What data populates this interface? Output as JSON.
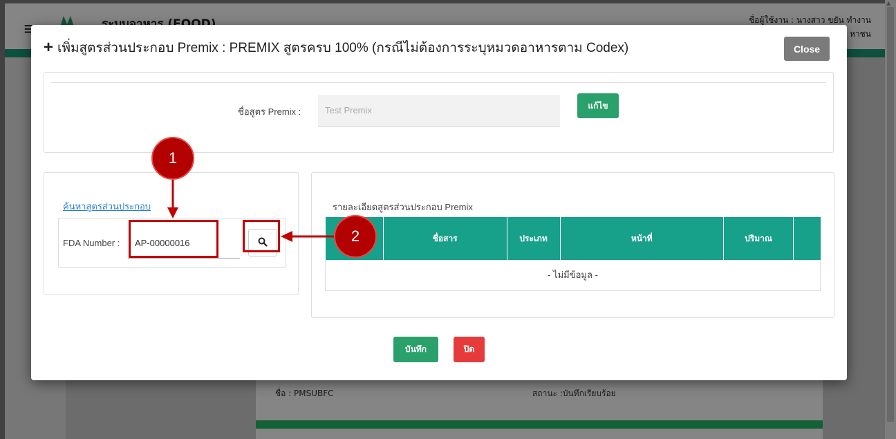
{
  "background": {
    "app_title": "ระบบอาหาร (FOOD)",
    "user_line1": "ชื่อผู้ใช้งาน : นางสาว ขยัน ทำงาน",
    "user_line2": "หาชน",
    "card_name": "ชื่อ : PMSUBFC",
    "card_status": "สถานะ :บันทึกเรียบร้อย"
  },
  "modal": {
    "title": "เพิ่มสูตรส่วนประกอบ Premix : PREMIX สูตรครบ 100% (กรณีไม่ต้องการระบุหมวดอาหารตาม Codex)",
    "close_label": "Close",
    "premix_name_label": "ชื่อสูตร Premix :",
    "premix_name_value": "Test Premix",
    "edit_label": "แก้ไข",
    "search_link": "ค้นหาสูตรส่วนประกอบ",
    "fda_label": "FDA Number :",
    "fda_value": "AP-00000016",
    "detail_title": "รายละเอียดสูตรส่วนประกอบ Premix",
    "table": {
      "headers": [
        "",
        "ชื่อสาร",
        "ประเภท",
        "หน้าที่",
        "ปริมาณ",
        ""
      ],
      "empty_text": "- ไม่มีข้อมูล -"
    },
    "save_label": "บันทึก",
    "cancel_label": "ปิด"
  },
  "annotations": {
    "step1": "1",
    "step2": "2",
    "color": "#c00000"
  },
  "colors": {
    "header_green": "#17a08a",
    "button_green": "#2aa06a",
    "button_red": "#e53b3b",
    "button_gray": "#7b7b7b"
  }
}
